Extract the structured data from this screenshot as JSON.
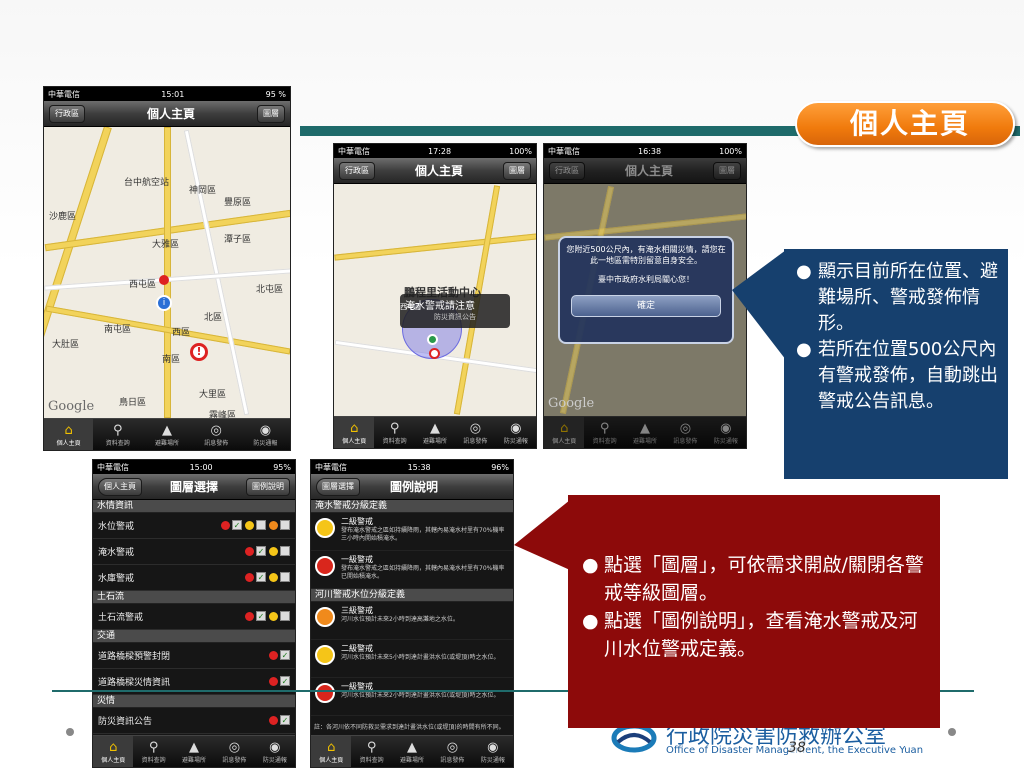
{
  "slide": {
    "title": "個人主頁",
    "page_number": "38"
  },
  "phone_common": {
    "carrier": "中華電信",
    "battery": "95 %"
  },
  "phone1": {
    "time": "15:01",
    "battery": "95 %",
    "left_btn": "行政區",
    "title": "個人主頁",
    "right_btn": "圖層",
    "map_labels": [
      "台中航空站",
      "神岡區",
      "豐原區",
      "沙鹿區",
      "大雅區",
      "潭子區",
      "西屯區",
      "北屯區",
      "南屯區",
      "北區",
      "大肚區",
      "西區",
      "南區",
      "大里區",
      "鳥日區",
      "霧峰區"
    ],
    "google": "Google",
    "tabs": [
      "個人主頁",
      "資料查詢",
      "避難場所",
      "訊息發佈",
      "防災通報"
    ]
  },
  "phone2": {
    "carrier": "中華電信",
    "time": "17:28",
    "battery": "100%",
    "left_btn": "行政區",
    "title": "個人主頁",
    "right_btn": "圖層",
    "popup_title": "淹水警戒請注意",
    "popup_sub": "防災資訊公告",
    "bg_label": "鵬程里活動中心",
    "bg_label2": "西屯區",
    "google": "Google",
    "tabs": [
      "個人主頁",
      "資料查詢",
      "避難場所",
      "訊息發佈",
      "防災通報"
    ]
  },
  "phone3": {
    "carrier": "中華電信",
    "time": "16:38",
    "battery": "100%",
    "left_btn": "行政區",
    "title": "個人主頁",
    "right_btn": "圖層",
    "alert_text": "您附近500公尺內，有淹水相關災情，請您在此一地區需特別留意自身安全。",
    "alert_from": "臺中市政府水利局關心您！",
    "alert_button": "確定",
    "google": "Google",
    "tabs": [
      "個人主頁",
      "資料查詢",
      "避難場所",
      "訊息發佈",
      "防災通報"
    ]
  },
  "phone4": {
    "carrier": "中華電信",
    "time": "15:00",
    "battery": "95%",
    "left_btn": "個人主頁",
    "title": "圖層選擇",
    "right_btn": "圖例說明",
    "sections": [
      {
        "header": "水情資訊",
        "rows": [
          "水位警戒",
          "淹水警戒",
          "水庫警戒"
        ]
      },
      {
        "header": "土石流",
        "rows": [
          "土石流警戒"
        ]
      },
      {
        "header": "交通",
        "rows": [
          "道路橋樑預警封閉",
          "道路橋樑災情資訊"
        ]
      },
      {
        "header": "災情",
        "rows": [
          "防災資訊公告"
        ]
      }
    ],
    "tabs": [
      "個人主頁",
      "資料查詢",
      "避難場所",
      "訊息發佈",
      "防災通報"
    ]
  },
  "phone5": {
    "carrier": "中華電信",
    "time": "15:38",
    "battery": "96%",
    "left_btn": "圖層選擇",
    "title": "圖例說明",
    "sections": [
      {
        "header": "淹水警戒分級定義",
        "items": [
          {
            "name": "二級警戒",
            "desc": "發布淹水警戒之區如持續降雨，其轄內易淹水村里有70%機率三小時內開始積淹水。",
            "color": "#f5c518"
          },
          {
            "name": "一級警戒",
            "desc": "發布淹水警戒之區如持續降雨，其轄內易淹水村里有70%機率已開始積淹水。",
            "color": "#d9261c"
          }
        ]
      },
      {
        "header": "河川警戒水位分級定義",
        "items": [
          {
            "name": "三級警戒",
            "desc": "河川水位預計未來2小時到達高灘地之水位。",
            "color": "#f08a1c"
          },
          {
            "name": "二級警戒",
            "desc": "河川水位預計未來5小時到達計畫洪水位(或堤頂)時之水位。",
            "color": "#f5c518"
          },
          {
            "name": "一級警戒",
            "desc": "河川水位預計未來2小時到達計畫洪水位(或堤頂)時之水位。",
            "color": "#d9261c"
          }
        ]
      }
    ],
    "note": "註：各河川依不同防救災需求到達計畫洪水位(或堤頂)的時間有所不同。",
    "tabs": [
      "個人主頁",
      "資料查詢",
      "避難場所",
      "訊息發佈",
      "防災通報"
    ]
  },
  "blue_callout": {
    "bullets": [
      "顯示目前所在位置、避難場所、警戒發佈情形。",
      "若所在位置500公尺內有警戒發佈，自動跳出警戒公告訊息。"
    ]
  },
  "red_callout": {
    "bullets": [
      "點選「圖層」，可依需求開啟/關閉各警戒等級圖層。",
      "點選「圖例說明」，查看淹水警戒及河川水位警戒定義。"
    ]
  },
  "logo": {
    "zh": "行政院災害防救辦公室",
    "en": "Office of Disaster Management, the Executive Yuan"
  },
  "colors": {
    "teal": "#1f6b6b",
    "orange": "#f07a0c",
    "blue": "#16406e",
    "red": "#8d0a0a"
  }
}
